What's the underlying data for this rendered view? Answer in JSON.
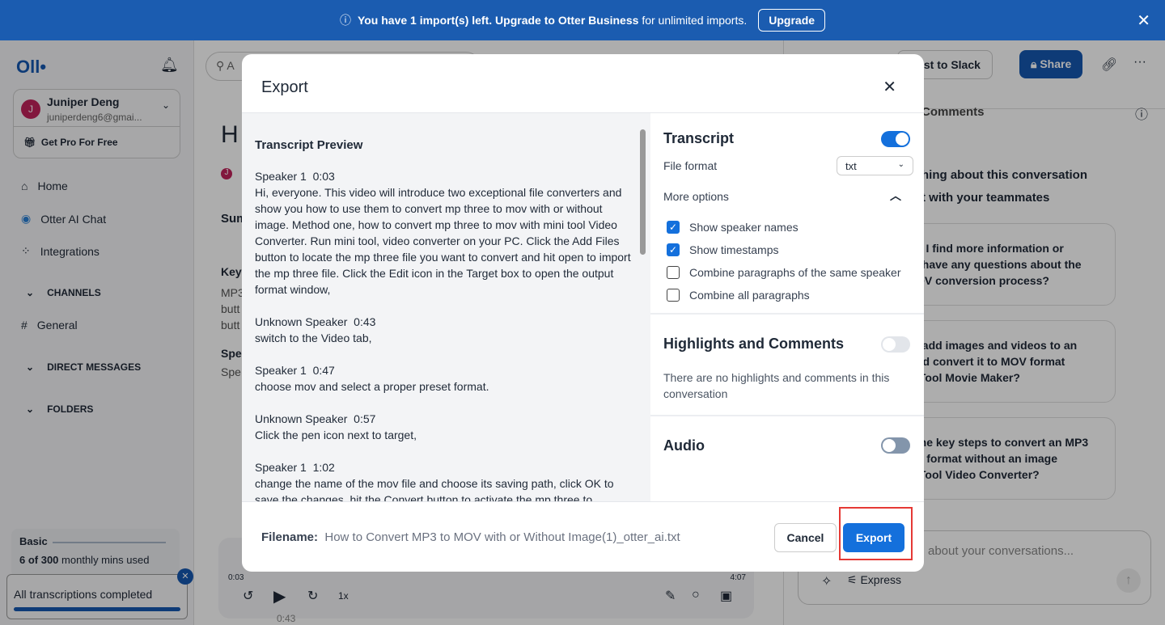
{
  "banner": {
    "pre": "You have 1 import(s) left. Upgrade to",
    "brand": "Otter Business",
    "post": "for unlimited imports.",
    "upgrade": "Upgrade"
  },
  "sidebar": {
    "logo": "Oll•",
    "user_name": "Juniper Deng",
    "user_initial": "J",
    "user_email": "juniperdeng6@gmai...",
    "pro": "Get Pro For Free",
    "nav": [
      "Home",
      "Otter AI Chat",
      "Integrations"
    ],
    "channels": "CHANNELS",
    "general": "General",
    "dm": "DIRECT MESSAGES",
    "folders": "FOLDERS",
    "plan": "Basic",
    "usage_bold": "6 of 300",
    "usage_rest": "monthly mins used",
    "transcriptions": "All transcriptions completed"
  },
  "main": {
    "search": "A",
    "title": "H",
    "initial": "J",
    "summary": "Sum",
    "key": "Key",
    "lines": [
      "MP3",
      "butt",
      "butt"
    ],
    "spe": "Spe",
    "spe2": "Spe",
    "player": {
      "start": "0:03",
      "end": "4:07",
      "speed": "1x",
      "ts": "0:43"
    }
  },
  "right": {
    "slack": "Post to Slack",
    "share": "Share",
    "comments": "Comments",
    "heading1": "hing about this conversation",
    "heading2": "t with your teammates",
    "questions": [
      "n I find more information or\nI have any questions about the\nOV conversion process?",
      "l add images and videos to an\nnd convert it to MOV format\niTool Movie Maker?",
      "the key steps to convert an MP3\nV format without an image\niTool Video Converter?"
    ],
    "ask": "about your conversations...",
    "express": "Express"
  },
  "modal": {
    "title": "Export",
    "preview_title": "Transcript Preview",
    "entries": [
      {
        "speaker": "Speaker 1  0:03",
        "text": "Hi, everyone. This video will introduce two exceptional file converters and show you how to use them to convert mp three to mov with or without image. Method one, how to convert mp three to mov with mini tool Video Converter. Run mini tool, video converter on your PC. Click the Add Files button to locate the mp three file you want to convert and hit open to import the mp three file. Click the Edit icon in the Target box to open the output format window,"
      },
      {
        "speaker": "Unknown Speaker  0:43",
        "text": "switch to the Video tab,"
      },
      {
        "speaker": "Speaker 1  0:47",
        "text": "choose mov and select a proper preset format."
      },
      {
        "speaker": "Unknown Speaker  0:57",
        "text": "Click the pen icon next to target,"
      },
      {
        "speaker": "Speaker 1  1:02",
        "text": "change the name of the mov file and choose its saving path, click OK to save the changes, hit the Convert button to activate the mp three to"
      }
    ],
    "transcript": "Transcript",
    "file_format_label": "File format",
    "file_format": "txt",
    "more_options": "More options",
    "options": [
      {
        "label": "Show speaker names",
        "checked": true
      },
      {
        "label": "Show timestamps",
        "checked": true
      },
      {
        "label": "Combine paragraphs of the same speaker",
        "checked": false
      },
      {
        "label": "Combine all paragraphs",
        "checked": false
      }
    ],
    "highlights": "Highlights and Comments",
    "no_highlights": "There are no highlights and comments in this conversation",
    "audio": "Audio",
    "filename_label": "Filename:",
    "filename": "How to Convert MP3 to MOV with or Without Image(1)_otter_ai.txt",
    "cancel": "Cancel",
    "export": "Export"
  }
}
